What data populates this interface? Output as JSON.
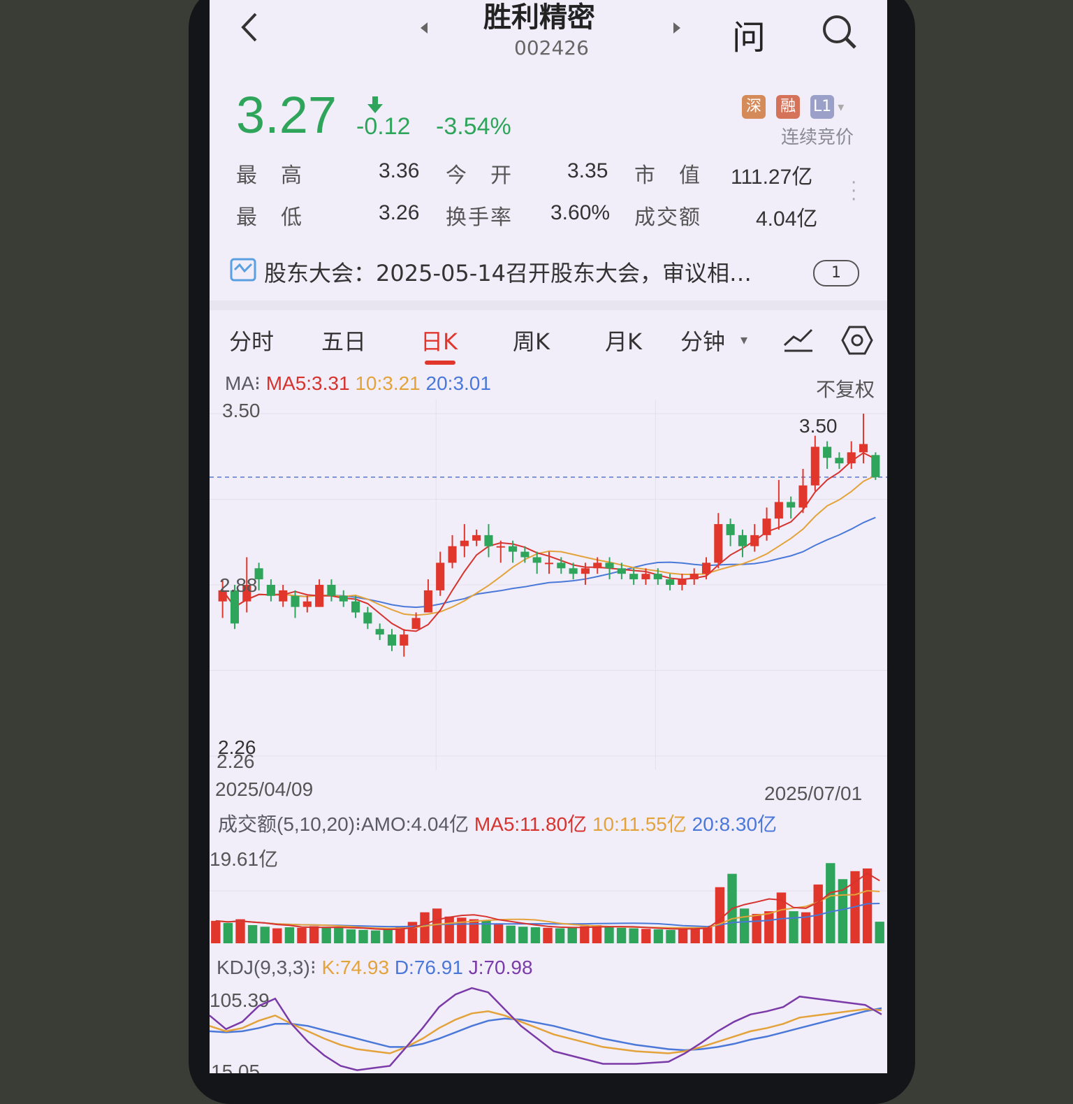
{
  "header": {
    "title": "胜利精密",
    "code": "002426",
    "ask_label": "问"
  },
  "quote": {
    "price": "3.27",
    "change": "-0.12",
    "change_pct": "-3.54%",
    "badges": [
      "深",
      "融",
      "L1"
    ],
    "trading_status": "连续竞价"
  },
  "stats": [
    {
      "label": "最　高",
      "value": "3.36"
    },
    {
      "label": "今　开",
      "value": "3.35"
    },
    {
      "label": "市　值",
      "value": "111.27亿"
    },
    {
      "label": "最　低",
      "value": "3.26"
    },
    {
      "label": "换手率",
      "value": "3.60%"
    },
    {
      "label": "成交额",
      "value": "4.04亿"
    }
  ],
  "notice": {
    "text": "股东大会：2025-05-14召开股东大会，审议相…",
    "page": "1"
  },
  "tabs": [
    {
      "label": "分时",
      "active": false
    },
    {
      "label": "五日",
      "active": false
    },
    {
      "label": "日K",
      "active": true
    },
    {
      "label": "周K",
      "active": false
    },
    {
      "label": "月K",
      "active": false
    },
    {
      "label": "分钟",
      "active": false
    }
  ],
  "ma_legend": {
    "prefix": "MA⁝",
    "ma5": "MA5:3.31",
    "ma10": "10:3.21",
    "ma20": "20:3.01",
    "adjust": "不复权"
  },
  "price_chart": {
    "y_top": "3.50",
    "y_mid": "2.88",
    "y_bottom": "2.26",
    "low_marker": "2.26",
    "high_marker": "3.50",
    "date_start": "2025/04/09",
    "date_end": "2025/07/01"
  },
  "amount_legend": {
    "prefix": "成交额(5,10,20)⁝AMO:4.04亿",
    "ma5": "MA5:11.80亿",
    "ma10": "10:11.55亿",
    "ma20": "20:8.30亿",
    "y_max": "19.61亿"
  },
  "kdj_legend": {
    "prefix": "KDJ(9,3,3)⁝",
    "k": "K:74.93",
    "d": "D:76.91",
    "j": "J:70.98",
    "y_max": "105.39",
    "y_min": "15.05"
  },
  "colors": {
    "up": "#e0362b",
    "down": "#2ea55a",
    "ma5": "#d7332e",
    "ma10": "#e3a33a",
    "ma20": "#4a78d8",
    "j_line": "#7a3aa8"
  },
  "chart_data": {
    "type": "candlestick",
    "x_range": [
      "2025/04/09",
      "2025/07/01"
    ],
    "ylim": [
      2.26,
      3.5
    ],
    "candles": [
      [
        2.82,
        2.86,
        2.76,
        2.9
      ],
      [
        2.86,
        2.74,
        2.72,
        2.88
      ],
      [
        2.82,
        2.88,
        2.78,
        2.98
      ],
      [
        2.94,
        2.9,
        2.86,
        2.96
      ],
      [
        2.88,
        2.84,
        2.82,
        2.9
      ],
      [
        2.82,
        2.86,
        2.8,
        2.88
      ],
      [
        2.84,
        2.8,
        2.76,
        2.86
      ],
      [
        2.8,
        2.82,
        2.78,
        2.84
      ],
      [
        2.8,
        2.88,
        2.8,
        2.9
      ],
      [
        2.88,
        2.84,
        2.82,
        2.9
      ],
      [
        2.84,
        2.82,
        2.8,
        2.86
      ],
      [
        2.82,
        2.78,
        2.76,
        2.84
      ],
      [
        2.78,
        2.74,
        2.72,
        2.8
      ],
      [
        2.72,
        2.7,
        2.68,
        2.74
      ],
      [
        2.7,
        2.66,
        2.64,
        2.72
      ],
      [
        2.66,
        2.7,
        2.62,
        2.72
      ],
      [
        2.72,
        2.76,
        2.72,
        2.78
      ],
      [
        2.78,
        2.86,
        2.78,
        2.9
      ],
      [
        2.86,
        2.96,
        2.84,
        3.0
      ],
      [
        2.96,
        3.02,
        2.94,
        3.06
      ],
      [
        3.02,
        3.04,
        2.98,
        3.1
      ],
      [
        3.04,
        3.06,
        3.02,
        3.08
      ],
      [
        3.06,
        3.02,
        2.98,
        3.1
      ],
      [
        3.02,
        3.02,
        2.96,
        3.04
      ],
      [
        3.02,
        3.0,
        2.96,
        3.04
      ],
      [
        3.0,
        2.98,
        2.96,
        3.02
      ],
      [
        2.98,
        2.96,
        2.92,
        3.0
      ],
      [
        2.96,
        2.96,
        2.92,
        3.0
      ],
      [
        2.96,
        2.94,
        2.92,
        2.98
      ],
      [
        2.94,
        2.92,
        2.9,
        2.96
      ],
      [
        2.92,
        2.94,
        2.88,
        2.96
      ],
      [
        2.94,
        2.96,
        2.92,
        2.98
      ],
      [
        2.96,
        2.94,
        2.9,
        2.98
      ],
      [
        2.94,
        2.92,
        2.9,
        2.96
      ],
      [
        2.92,
        2.9,
        2.88,
        2.94
      ],
      [
        2.9,
        2.92,
        2.88,
        2.94
      ],
      [
        2.92,
        2.9,
        2.88,
        2.94
      ],
      [
        2.9,
        2.88,
        2.86,
        2.92
      ],
      [
        2.88,
        2.9,
        2.86,
        2.92
      ],
      [
        2.9,
        2.92,
        2.88,
        2.94
      ],
      [
        2.92,
        2.96,
        2.9,
        2.98
      ],
      [
        2.96,
        3.1,
        2.94,
        3.14
      ],
      [
        3.1,
        3.06,
        3.02,
        3.12
      ],
      [
        3.06,
        3.02,
        2.98,
        3.08
      ],
      [
        3.02,
        3.06,
        3.0,
        3.1
      ],
      [
        3.06,
        3.12,
        3.04,
        3.16
      ],
      [
        3.12,
        3.18,
        3.08,
        3.26
      ],
      [
        3.18,
        3.16,
        3.12,
        3.2
      ],
      [
        3.16,
        3.24,
        3.14,
        3.3
      ],
      [
        3.24,
        3.38,
        3.22,
        3.42
      ],
      [
        3.38,
        3.34,
        3.3,
        3.4
      ],
      [
        3.34,
        3.32,
        3.3,
        3.36
      ],
      [
        3.32,
        3.36,
        3.3,
        3.4
      ],
      [
        3.36,
        3.39,
        3.32,
        3.5
      ],
      [
        3.35,
        3.27,
        3.26,
        3.36
      ]
    ],
    "ma5_last": 3.31,
    "ma10_last": 3.21,
    "ma20_last": 3.01,
    "amount_ylim": [
      0,
      19.61
    ],
    "amounts": [
      4.2,
      3.8,
      4.5,
      3.4,
      3.1,
      2.8,
      3.0,
      2.9,
      3.2,
      3.0,
      2.9,
      2.6,
      2.5,
      2.4,
      2.6,
      3.1,
      4.0,
      5.8,
      6.5,
      5.0,
      4.8,
      4.5,
      4.2,
      3.6,
      3.3,
      3.1,
      3.0,
      2.9,
      2.8,
      3.0,
      3.2,
      3.4,
      3.1,
      2.9,
      2.8,
      2.7,
      2.6,
      2.5,
      2.8,
      3.0,
      3.2,
      10.5,
      13.0,
      6.5,
      5.5,
      6.0,
      9.5,
      6.0,
      5.8,
      11.0,
      15.0,
      12.0,
      13.5,
      14.0,
      4.04
    ],
    "kdj": {
      "k": [
        60,
        55,
        58,
        65,
        70,
        62,
        55,
        48,
        42,
        38,
        36,
        34,
        40,
        48,
        58,
        66,
        72,
        74,
        70,
        64,
        58,
        52,
        48,
        44,
        40,
        38,
        36,
        35,
        34,
        36,
        40,
        45,
        50,
        55,
        58,
        62,
        68,
        70,
        72,
        74,
        76,
        74.93
      ],
      "d": [
        55,
        54,
        55,
        58,
        62,
        62,
        60,
        56,
        52,
        48,
        44,
        40,
        40,
        43,
        48,
        54,
        60,
        65,
        67,
        66,
        63,
        60,
        56,
        52,
        48,
        45,
        42,
        40,
        38,
        37,
        38,
        40,
        43,
        47,
        50,
        54,
        58,
        62,
        66,
        70,
        74,
        76.91
      ],
      "j": [
        70,
        57,
        64,
        79,
        86,
        62,
        45,
        32,
        22,
        18,
        20,
        22,
        40,
        58,
        78,
        90,
        96,
        92,
        76,
        60,
        48,
        36,
        32,
        28,
        24,
        24,
        24,
        25,
        26,
        34,
        44,
        55,
        64,
        71,
        74,
        78,
        88,
        86,
        84,
        82,
        80,
        70.98
      ]
    }
  }
}
